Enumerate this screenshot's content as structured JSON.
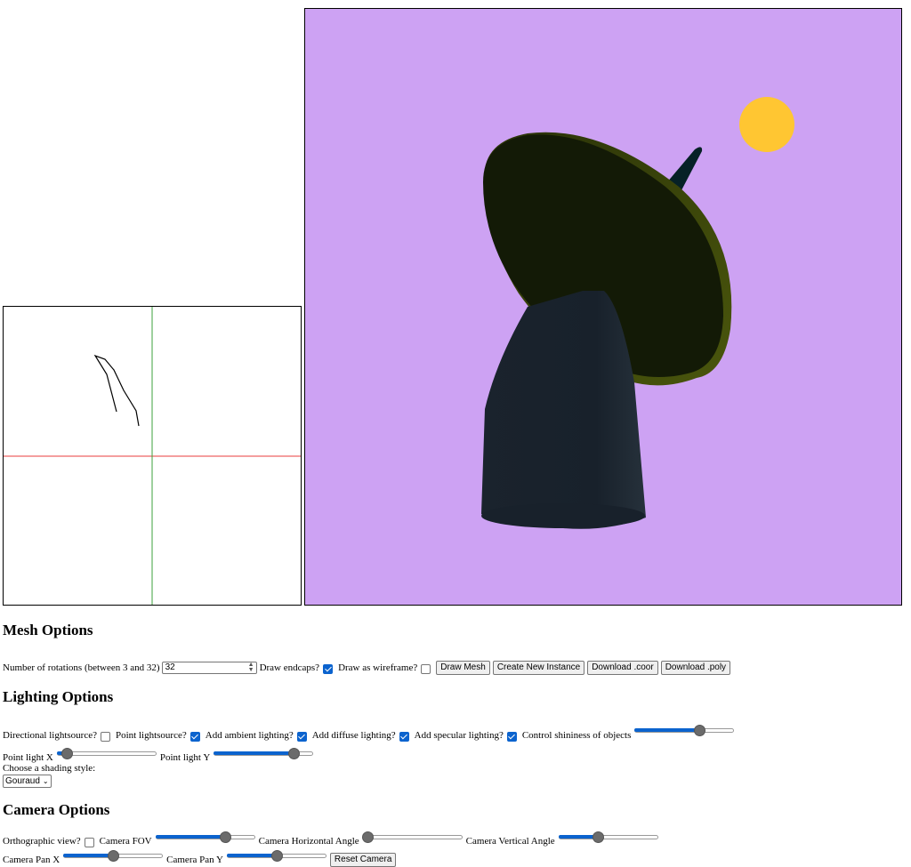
{
  "mesh": {
    "heading": "Mesh Options",
    "rotations_label": "Number of rotations (between 3 and 32)",
    "rotations_value": "32",
    "endcaps_label": "Draw endcaps?",
    "endcaps_checked": true,
    "wireframe_label": "Draw as wireframe?",
    "wireframe_checked": false,
    "buttons": [
      "Draw Mesh",
      "Create New Instance",
      "Download .coor",
      "Download .poly"
    ]
  },
  "lighting": {
    "heading": "Lighting Options",
    "directional_label": "Directional lightsource?",
    "directional_checked": false,
    "point_label": "Point lightsource?",
    "point_checked": true,
    "ambient_label": "Add ambient lighting?",
    "ambient_checked": true,
    "diffuse_label": "Add diffuse lighting?",
    "diffuse_checked": true,
    "specular_label": "Add specular lighting?",
    "specular_checked": true,
    "shininess_label": "Control shininess of objects",
    "shininess_value": 0.65,
    "point_x_label": "Point light X",
    "point_x_value": 0.1,
    "point_y_label": "Point light Y",
    "point_y_value": 0.8,
    "shading_label": "Choose a shading style:",
    "shading_value": "Gouraud"
  },
  "camera": {
    "heading": "Camera Options",
    "ortho_label": "Orthographic view?",
    "ortho_checked": false,
    "fov_label": "Camera FOV",
    "fov_value": 0.7,
    "hangle_label": "Camera Horizontal Angle",
    "hangle_value": 0.05,
    "vangle_label": "Camera Vertical Angle",
    "vangle_value": 0.4,
    "panx_label": "Camera Pan X",
    "panx_value": 0.5,
    "pany_label": "Camera Pan Y",
    "pany_value": 0.5,
    "reset_label": "Reset Camera"
  },
  "colors": {
    "viewport_bg": "#cda2f3",
    "sun": "#ffc632",
    "dish": "#131a06",
    "dish_rim": "#3f4a0a",
    "base": "#18212b",
    "antenna": "#062126",
    "x_axis": "#e83c3c",
    "y_axis": "#3ca03c",
    "accent": "#0b63ce"
  }
}
